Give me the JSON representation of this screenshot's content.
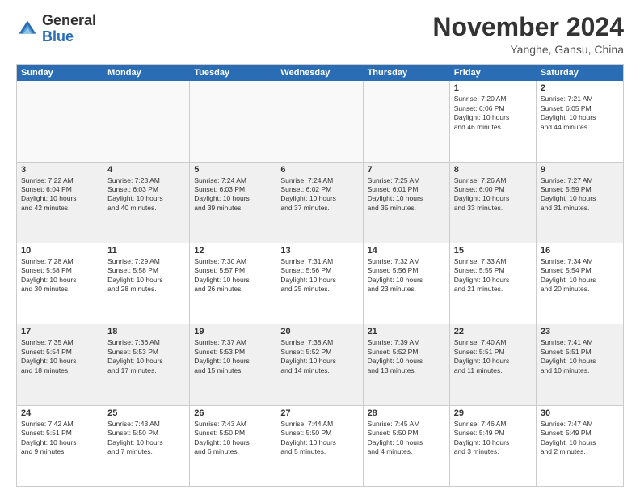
{
  "logo": {
    "general": "General",
    "blue": "Blue"
  },
  "title": "November 2024",
  "location": "Yanghe, Gansu, China",
  "header_days": [
    "Sunday",
    "Monday",
    "Tuesday",
    "Wednesday",
    "Thursday",
    "Friday",
    "Saturday"
  ],
  "rows": [
    [
      {
        "day": "",
        "info": "",
        "empty": true
      },
      {
        "day": "",
        "info": "",
        "empty": true
      },
      {
        "day": "",
        "info": "",
        "empty": true
      },
      {
        "day": "",
        "info": "",
        "empty": true
      },
      {
        "day": "",
        "info": "",
        "empty": true
      },
      {
        "day": "1",
        "info": "Sunrise: 7:20 AM\nSunset: 6:06 PM\nDaylight: 10 hours\nand 46 minutes."
      },
      {
        "day": "2",
        "info": "Sunrise: 7:21 AM\nSunset: 6:05 PM\nDaylight: 10 hours\nand 44 minutes."
      }
    ],
    [
      {
        "day": "3",
        "info": "Sunrise: 7:22 AM\nSunset: 6:04 PM\nDaylight: 10 hours\nand 42 minutes."
      },
      {
        "day": "4",
        "info": "Sunrise: 7:23 AM\nSunset: 6:03 PM\nDaylight: 10 hours\nand 40 minutes."
      },
      {
        "day": "5",
        "info": "Sunrise: 7:24 AM\nSunset: 6:03 PM\nDaylight: 10 hours\nand 39 minutes."
      },
      {
        "day": "6",
        "info": "Sunrise: 7:24 AM\nSunset: 6:02 PM\nDaylight: 10 hours\nand 37 minutes."
      },
      {
        "day": "7",
        "info": "Sunrise: 7:25 AM\nSunset: 6:01 PM\nDaylight: 10 hours\nand 35 minutes."
      },
      {
        "day": "8",
        "info": "Sunrise: 7:26 AM\nSunset: 6:00 PM\nDaylight: 10 hours\nand 33 minutes."
      },
      {
        "day": "9",
        "info": "Sunrise: 7:27 AM\nSunset: 5:59 PM\nDaylight: 10 hours\nand 31 minutes."
      }
    ],
    [
      {
        "day": "10",
        "info": "Sunrise: 7:28 AM\nSunset: 5:58 PM\nDaylight: 10 hours\nand 30 minutes."
      },
      {
        "day": "11",
        "info": "Sunrise: 7:29 AM\nSunset: 5:58 PM\nDaylight: 10 hours\nand 28 minutes."
      },
      {
        "day": "12",
        "info": "Sunrise: 7:30 AM\nSunset: 5:57 PM\nDaylight: 10 hours\nand 26 minutes."
      },
      {
        "day": "13",
        "info": "Sunrise: 7:31 AM\nSunset: 5:56 PM\nDaylight: 10 hours\nand 25 minutes."
      },
      {
        "day": "14",
        "info": "Sunrise: 7:32 AM\nSunset: 5:56 PM\nDaylight: 10 hours\nand 23 minutes."
      },
      {
        "day": "15",
        "info": "Sunrise: 7:33 AM\nSunset: 5:55 PM\nDaylight: 10 hours\nand 21 minutes."
      },
      {
        "day": "16",
        "info": "Sunrise: 7:34 AM\nSunset: 5:54 PM\nDaylight: 10 hours\nand 20 minutes."
      }
    ],
    [
      {
        "day": "17",
        "info": "Sunrise: 7:35 AM\nSunset: 5:54 PM\nDaylight: 10 hours\nand 18 minutes."
      },
      {
        "day": "18",
        "info": "Sunrise: 7:36 AM\nSunset: 5:53 PM\nDaylight: 10 hours\nand 17 minutes."
      },
      {
        "day": "19",
        "info": "Sunrise: 7:37 AM\nSunset: 5:53 PM\nDaylight: 10 hours\nand 15 minutes."
      },
      {
        "day": "20",
        "info": "Sunrise: 7:38 AM\nSunset: 5:52 PM\nDaylight: 10 hours\nand 14 minutes."
      },
      {
        "day": "21",
        "info": "Sunrise: 7:39 AM\nSunset: 5:52 PM\nDaylight: 10 hours\nand 13 minutes."
      },
      {
        "day": "22",
        "info": "Sunrise: 7:40 AM\nSunset: 5:51 PM\nDaylight: 10 hours\nand 11 minutes."
      },
      {
        "day": "23",
        "info": "Sunrise: 7:41 AM\nSunset: 5:51 PM\nDaylight: 10 hours\nand 10 minutes."
      }
    ],
    [
      {
        "day": "24",
        "info": "Sunrise: 7:42 AM\nSunset: 5:51 PM\nDaylight: 10 hours\nand 9 minutes."
      },
      {
        "day": "25",
        "info": "Sunrise: 7:43 AM\nSunset: 5:50 PM\nDaylight: 10 hours\nand 7 minutes."
      },
      {
        "day": "26",
        "info": "Sunrise: 7:43 AM\nSunset: 5:50 PM\nDaylight: 10 hours\nand 6 minutes."
      },
      {
        "day": "27",
        "info": "Sunrise: 7:44 AM\nSunset: 5:50 PM\nDaylight: 10 hours\nand 5 minutes."
      },
      {
        "day": "28",
        "info": "Sunrise: 7:45 AM\nSunset: 5:50 PM\nDaylight: 10 hours\nand 4 minutes."
      },
      {
        "day": "29",
        "info": "Sunrise: 7:46 AM\nSunset: 5:49 PM\nDaylight: 10 hours\nand 3 minutes."
      },
      {
        "day": "30",
        "info": "Sunrise: 7:47 AM\nSunset: 5:49 PM\nDaylight: 10 hours\nand 2 minutes."
      }
    ]
  ]
}
